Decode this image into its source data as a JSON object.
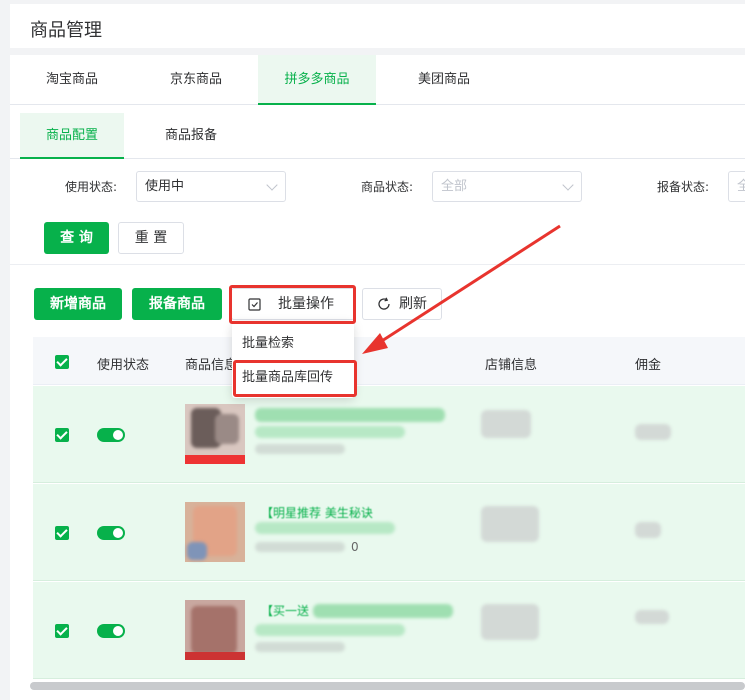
{
  "header": {
    "title": "商品管理"
  },
  "platform_tabs": [
    "淘宝商品",
    "京东商品",
    "拼多多商品",
    "美团商品"
  ],
  "sub_tabs": [
    "商品配置",
    "商品报备"
  ],
  "filters": {
    "use_status": {
      "label": "使用状态:",
      "value": "使用中"
    },
    "product_status": {
      "label": "商品状态:",
      "value": "全部"
    },
    "report_status": {
      "label": "报备状态:",
      "value": "全"
    }
  },
  "buttons": {
    "query": "查 询",
    "reset": "重 置",
    "add": "新增商品",
    "report": "报备商品",
    "batch": "批量操作",
    "refresh": "刷新"
  },
  "dropdown": [
    "批量检索",
    "批量商品库回传"
  ],
  "table": {
    "headers": [
      "使用状态",
      "商品信息",
      "店铺信息",
      "佣金"
    ]
  },
  "rows": [
    {
      "checked": true,
      "enabled": true,
      "price_fragment": "0"
    },
    {
      "checked": true,
      "enabled": true,
      "title_fragment": "【明星推荐 美生秘诀",
      "price_fragment": "0"
    },
    {
      "checked": true,
      "enabled": true,
      "title_fragment": "【买一送",
      "price_fragment": ""
    }
  ],
  "colors": {
    "accent": "#07b14b",
    "highlight": "#e8342e"
  }
}
